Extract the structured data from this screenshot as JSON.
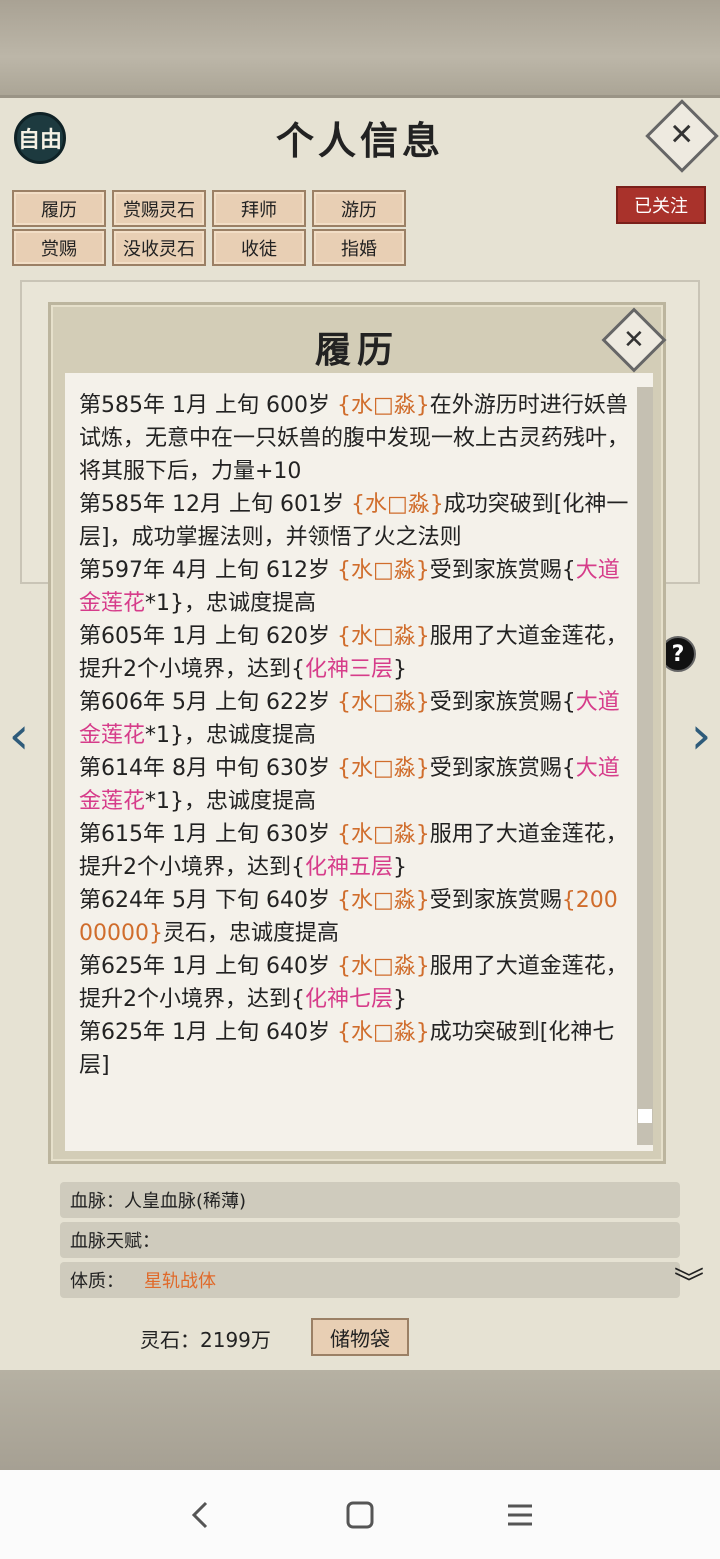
{
  "header": {
    "mode_badge": "自由",
    "title": "个人信息"
  },
  "tabs": [
    {
      "label": "履历"
    },
    {
      "label": "赏赐灵石"
    },
    {
      "label": "拜师"
    },
    {
      "label": "游历"
    },
    {
      "label": "赏赐"
    },
    {
      "label": "没收灵石"
    },
    {
      "label": "收徒"
    },
    {
      "label": "指婚"
    }
  ],
  "follow_label": "已关注",
  "background": {
    "bloodline_label": "血脉：",
    "bloodline_value": "人皇血脉(稀薄)",
    "bloodline_talent_label": "血脉天赋：",
    "physique_label": "体质：",
    "physique_value": "星轨战体",
    "spirit_stone_text": "灵石：2199万",
    "bag_label": "储物袋"
  },
  "modal": {
    "title": "履历",
    "entries": [
      [
        {
          "t": "第585年 1月 上旬 600岁 "
        },
        {
          "t": "{水□淼}",
          "c": "name"
        },
        {
          "t": "在外游历时进行妖兽试炼，无意中在一只妖兽的腹中发现一枚上古灵药残叶，将其服下后，力量+10"
        }
      ],
      [
        {
          "t": "第585年 12月 上旬 601岁 "
        },
        {
          "t": "{水□淼}",
          "c": "name"
        },
        {
          "t": "成功突破到[化神一层]，成功掌握法则，并领悟了火之法则"
        }
      ],
      [
        {
          "t": "第597年 4月 上旬 612岁 "
        },
        {
          "t": "{水□淼}",
          "c": "name"
        },
        {
          "t": "受到家族赏赐{"
        },
        {
          "t": "大道金莲花",
          "c": "pink"
        },
        {
          "t": "*1}，忠诚度提高"
        }
      ],
      [
        {
          "t": "第605年 1月 上旬 620岁 "
        },
        {
          "t": "{水□淼}",
          "c": "name"
        },
        {
          "t": "服用了大道金莲花，提升2个小境界，达到{"
        },
        {
          "t": "化神三层",
          "c": "pink"
        },
        {
          "t": "}"
        }
      ],
      [
        {
          "t": "第606年 5月 上旬 622岁 "
        },
        {
          "t": "{水□淼}",
          "c": "name"
        },
        {
          "t": "受到家族赏赐{"
        },
        {
          "t": "大道金莲花",
          "c": "pink"
        },
        {
          "t": "*1}，忠诚度提高"
        }
      ],
      [
        {
          "t": "第614年 8月 中旬 630岁 "
        },
        {
          "t": "{水□淼}",
          "c": "name"
        },
        {
          "t": "受到家族赏赐{"
        },
        {
          "t": "大道金莲花",
          "c": "pink"
        },
        {
          "t": "*1}，忠诚度提高"
        }
      ],
      [
        {
          "t": "第615年 1月 上旬 630岁 "
        },
        {
          "t": "{水□淼}",
          "c": "name"
        },
        {
          "t": "服用了大道金莲花，提升2个小境界，达到{"
        },
        {
          "t": "化神五层",
          "c": "pink"
        },
        {
          "t": "}"
        }
      ],
      [
        {
          "t": "第624年  5月  下旬   640岁   "
        },
        {
          "t": "{水□淼}",
          "c": "name"
        },
        {
          "t": "受到家族赏赐"
        },
        {
          "t": "{20000000}",
          "c": "name"
        },
        {
          "t": "灵石，忠诚度提高"
        }
      ],
      [
        {
          "t": "第625年 1月 上旬 640岁 "
        },
        {
          "t": "{水□淼}",
          "c": "name"
        },
        {
          "t": "服用了大道金莲花，提升2个小境界，达到{"
        },
        {
          "t": "化神七层",
          "c": "pink"
        },
        {
          "t": "}"
        }
      ],
      [
        {
          "t": "第625年 1月 上旬  640岁 "
        },
        {
          "t": "{水□淼}",
          "c": "name"
        },
        {
          "t": "成功突破到[化神七层]"
        }
      ]
    ]
  },
  "colors": {
    "name": "#d06d2c",
    "pink": "#d63c8a",
    "accent_red": "#a9322b"
  },
  "icons": {
    "close": "close-icon",
    "help": "question-icon",
    "left": "chevron-left-icon",
    "right": "chevron-right-icon",
    "expand": "chevron-down-double-icon"
  }
}
